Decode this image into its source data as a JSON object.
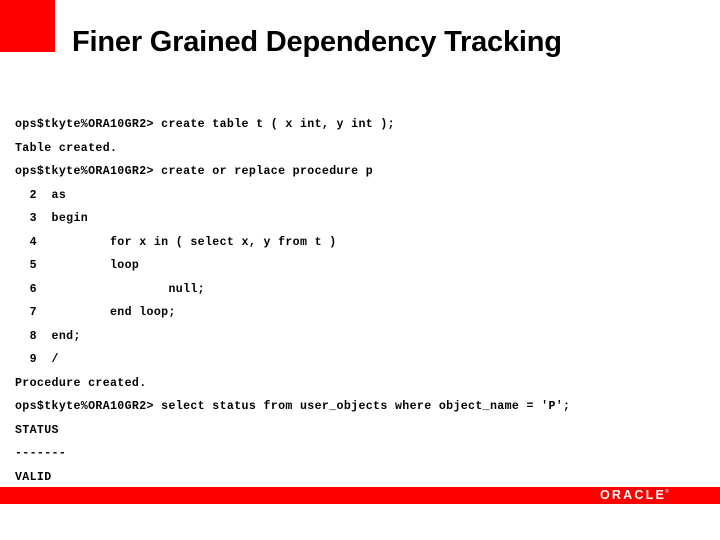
{
  "slide": {
    "title": "Finer Grained Dependency Tracking",
    "accent_color": "#ff0000",
    "background_color": "#ffffff",
    "text_color": "#000000"
  },
  "terminal": {
    "prompt": "ops$tkyte%ORA10GR2>",
    "lines": [
      {
        "id": "line-1",
        "text": "ops$tkyte%ORA10GR2> create table t ( x int, y int );"
      },
      {
        "id": "line-2",
        "text": "Table created."
      },
      {
        "id": "line-3",
        "text": "ops$tkyte%ORA10GR2> create or replace procedure p"
      },
      {
        "id": "line-4",
        "text": "  2  as"
      },
      {
        "id": "line-5",
        "text": "  3  begin"
      },
      {
        "id": "line-6",
        "text": "  4          for x in ( select x, y from t )"
      },
      {
        "id": "line-7",
        "text": "  5          loop"
      },
      {
        "id": "line-8",
        "text": "  6                  null;"
      },
      {
        "id": "line-9",
        "text": "  7          end loop;"
      },
      {
        "id": "line-10",
        "text": "  8  end;"
      },
      {
        "id": "line-11",
        "text": "  9  /"
      },
      {
        "id": "line-12",
        "text": "Procedure created."
      },
      {
        "id": "line-13",
        "text": "ops$tkyte%ORA10GR2> select status from user_objects where object_name = 'P';"
      },
      {
        "id": "line-14",
        "text": "STATUS"
      },
      {
        "id": "line-15",
        "text": "-------"
      },
      {
        "id": "line-16",
        "text": "VALID"
      }
    ]
  },
  "footer": {
    "logo_text": "ORACLE",
    "logo_tm": "®",
    "bar_color": "#ff0000"
  }
}
